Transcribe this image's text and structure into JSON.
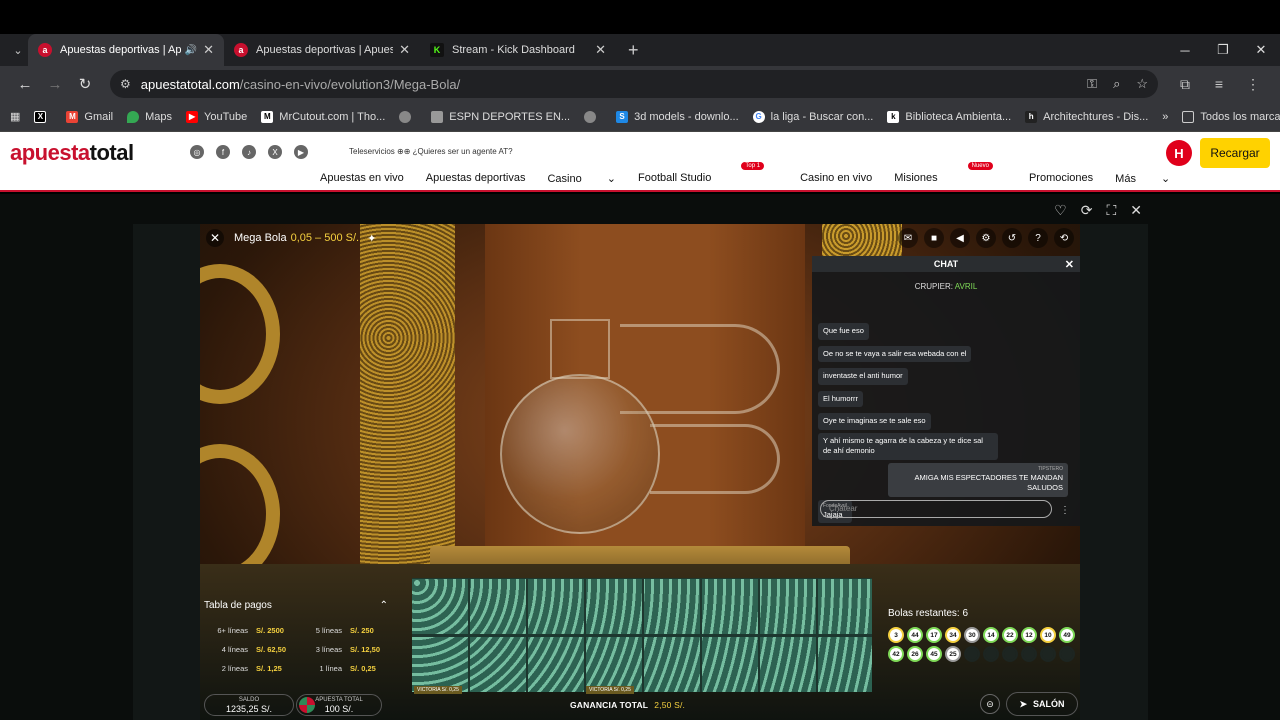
{
  "browser": {
    "tabs": [
      {
        "label": "Apuestas deportivas | Apue",
        "active": true
      },
      {
        "label": "Apuestas deportivas | Apuestas",
        "active": false
      },
      {
        "label": "Stream - Kick Dashboard",
        "active": false
      }
    ],
    "url_host": "apuestatotal.com",
    "url_path": "/casino-en-vivo/evolution3/Mega-Bola/",
    "bookmarks": [
      "Gmail",
      "Maps",
      "YouTube",
      "MrCutout.com | Tho...",
      "ESPN DEPORTES EN...",
      "3d models - downlo...",
      "la liga - Buscar con...",
      "Biblioteca Ambienta...",
      "Architechtures - Dis..."
    ],
    "bookmarks_all": "Todos los marcadores"
  },
  "site": {
    "logo_a": "apuesta",
    "logo_b": "total",
    "teleservicios": "Teleservicios",
    "agent_text": "¿Quieres ser un agente AT?",
    "menu": [
      "Apuestas en vivo",
      "Apuestas deportivas",
      "Casino",
      "Football Studio",
      "Casino en vivo",
      "Misiones",
      "Promociones",
      "Más"
    ],
    "badge_top": "Top 1",
    "badge_nuevo": "Nuevo",
    "avatar": "H",
    "recargar": "Recargar"
  },
  "game": {
    "title": "Mega Bola",
    "limits": "0,05 – 500 S/.",
    "chat": {
      "header": "CHAT",
      "crupier_label": "CRUPIER:",
      "crupier_name": "AVRIL",
      "messages": [
        "Que fue eso",
        "Oe no se te vaya a salir esa webada con el",
        "inventaste el anti humor",
        "El humorrr",
        "Oye te imaginas se te sale eso",
        "Y ahí mismo te agarra de la cabeza y te dice sal de ahí demonio"
      ],
      "reply_nick": "TIPSTERO",
      "reply": "AMIGA MIS ESPECTADORES TE MANDAN SALUDOS",
      "last_nick": "FondoAvril",
      "last": "Jajaja",
      "placeholder": "Chatear"
    },
    "paytable": {
      "title": "Tabla de pagos",
      "rows": [
        {
          "l1": "6+ líneas",
          "v1": "S/. 2500",
          "l2": "5 líneas",
          "v2": "S/. 250"
        },
        {
          "l1": "4 líneas",
          "v1": "S/. 62,50",
          "l2": "3 líneas",
          "v2": "S/. 12,50"
        },
        {
          "l1": "2 líneas",
          "v1": "S/. 1,25",
          "l2": "1 línea",
          "v2": "S/. 0,25"
        }
      ]
    },
    "victoria_a": "VICTORIA S/. 0,25",
    "victoria_b": "VICTORIA S/. 0,25",
    "bolas_title": "Bolas restantes: 6",
    "balls": [
      {
        "n": "3",
        "c": "y"
      },
      {
        "n": "44",
        "c": "g"
      },
      {
        "n": "17",
        "c": "g"
      },
      {
        "n": "34",
        "c": "y"
      },
      {
        "n": "30",
        "c": "n"
      },
      {
        "n": "14",
        "c": "g"
      },
      {
        "n": "22",
        "c": "g"
      },
      {
        "n": "12",
        "c": "g"
      },
      {
        "n": "10",
        "c": "y"
      },
      {
        "n": "49",
        "c": "g"
      },
      {
        "n": "42",
        "c": "g"
      },
      {
        "n": "26",
        "c": "g"
      },
      {
        "n": "45",
        "c": "g"
      },
      {
        "n": "25",
        "c": "n"
      }
    ],
    "saldo_label": "SALDO",
    "saldo": "1235,25 S/.",
    "apuesta_label": "APUESTA TOTAL",
    "apuesta": "100 S/.",
    "ganancia_label": "GANANCIA TOTAL",
    "ganancia": "2,50 S/.",
    "salon": "SALÓN"
  }
}
